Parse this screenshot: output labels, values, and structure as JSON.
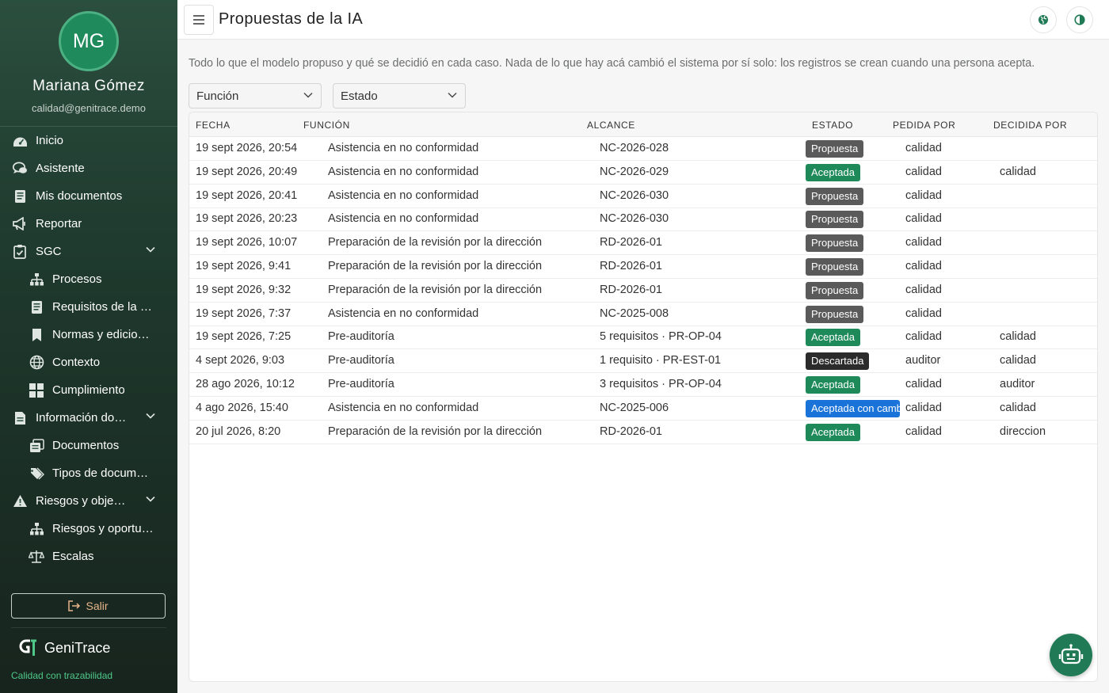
{
  "sidebar": {
    "avatar_initials": "MG",
    "user_name": "Mariana Gómez",
    "user_email": "calidad@genitrace.demo",
    "items": [
      {
        "label": "Inicio",
        "icon": "dashboard-icon",
        "level": 0
      },
      {
        "label": "Asistente",
        "icon": "chat-icon",
        "level": 0
      },
      {
        "label": "Mis documentos",
        "icon": "document-icon",
        "level": 0
      },
      {
        "label": "Reportar",
        "icon": "megaphone-icon",
        "level": 0
      },
      {
        "label": "SGC",
        "icon": "clipboard-check-icon",
        "level": 0,
        "expanded": true
      },
      {
        "label": "Procesos",
        "icon": "sitemap-icon",
        "level": 1
      },
      {
        "label": "Requisitos de la norma",
        "icon": "document-icon",
        "level": 1
      },
      {
        "label": "Normas y ediciones",
        "icon": "bookmark-icon",
        "level": 1
      },
      {
        "label": "Contexto",
        "icon": "globe-icon",
        "level": 1
      },
      {
        "label": "Cumplimiento",
        "icon": "grid-icon",
        "level": 1
      },
      {
        "label": "Información documentada",
        "icon": "file-icon",
        "level": 0,
        "expanded": true
      },
      {
        "label": "Documentos",
        "icon": "files-icon",
        "level": 1
      },
      {
        "label": "Tipos de documento",
        "icon": "tags-icon",
        "level": 1
      },
      {
        "label": "Riesgos y objetivos",
        "icon": "warning-icon",
        "level": 0,
        "expanded": true
      },
      {
        "label": "Riesgos y oportunidades",
        "icon": "sitemap-icon",
        "level": 1
      },
      {
        "label": "Escalas",
        "icon": "scale-icon",
        "level": 1
      }
    ],
    "logout_label": "Salir",
    "brand_name": "GeniTrace",
    "brand_tagline": "Calidad con trazabilidad"
  },
  "header": {
    "title": "Propuestas de la IA"
  },
  "main": {
    "intro": "Todo lo que el modelo propuso y qué se decidió en cada caso. Nada de lo que hay acá cambió el sistema por sí solo: los registros se crean cuando una persona acepta.",
    "filters": [
      {
        "label": "Función"
      },
      {
        "label": "Estado"
      }
    ],
    "columns": [
      "FECHA",
      "FUNCIÓN",
      "ALCANCE",
      "ESTADO",
      "PEDIDA POR",
      "DECIDIDA POR"
    ],
    "rows": [
      {
        "fecha": "19 sept 2026, 20:54",
        "funcion": "Asistencia en no conformidad",
        "alcance": "NC-2026-028",
        "estado": "Propuesta",
        "estado_color": "#5a5a5a",
        "pedida": "calidad",
        "decidida": ""
      },
      {
        "fecha": "19 sept 2026, 20:49",
        "funcion": "Asistencia en no conformidad",
        "alcance": "NC-2026-029",
        "estado": "Aceptada",
        "estado_color": "#1e8a5a",
        "pedida": "calidad",
        "decidida": "calidad"
      },
      {
        "fecha": "19 sept 2026, 20:41",
        "funcion": "Asistencia en no conformidad",
        "alcance": "NC-2026-030",
        "estado": "Propuesta",
        "estado_color": "#5a5a5a",
        "pedida": "calidad",
        "decidida": ""
      },
      {
        "fecha": "19 sept 2026, 20:23",
        "funcion": "Asistencia en no conformidad",
        "alcance": "NC-2026-030",
        "estado": "Propuesta",
        "estado_color": "#5a5a5a",
        "pedida": "calidad",
        "decidida": ""
      },
      {
        "fecha": "19 sept 2026, 10:07",
        "funcion": "Preparación de la revisión por la dirección",
        "alcance": "RD-2026-01",
        "estado": "Propuesta",
        "estado_color": "#5a5a5a",
        "pedida": "calidad",
        "decidida": ""
      },
      {
        "fecha": "19 sept 2026, 9:41",
        "funcion": "Preparación de la revisión por la dirección",
        "alcance": "RD-2026-01",
        "estado": "Propuesta",
        "estado_color": "#5a5a5a",
        "pedida": "calidad",
        "decidida": ""
      },
      {
        "fecha": "19 sept 2026, 9:32",
        "funcion": "Preparación de la revisión por la dirección",
        "alcance": "RD-2026-01",
        "estado": "Propuesta",
        "estado_color": "#5a5a5a",
        "pedida": "calidad",
        "decidida": ""
      },
      {
        "fecha": "19 sept 2026, 7:37",
        "funcion": "Asistencia en no conformidad",
        "alcance": "NC-2025-008",
        "estado": "Propuesta",
        "estado_color": "#5a5a5a",
        "pedida": "calidad",
        "decidida": ""
      },
      {
        "fecha": "19 sept 2026, 7:25",
        "funcion": "Pre-auditoría",
        "alcance": "5 requisitos · PR-OP-04",
        "estado": "Aceptada",
        "estado_color": "#1e8a5a",
        "pedida": "calidad",
        "decidida": "calidad"
      },
      {
        "fecha": "4 sept 2026, 9:03",
        "funcion": "Pre-auditoría",
        "alcance": "1 requisito · PR-EST-01",
        "estado": "Descartada",
        "estado_color": "#2b2b2b",
        "pedida": "auditor",
        "decidida": "calidad"
      },
      {
        "fecha": "28 ago 2026, 10:12",
        "funcion": "Pre-auditoría",
        "alcance": "3 requisitos · PR-OP-04",
        "estado": "Aceptada",
        "estado_color": "#1e8a5a",
        "pedida": "calidad",
        "decidida": "auditor"
      },
      {
        "fecha": "4 ago 2026, 15:40",
        "funcion": "Asistencia en no conformidad",
        "alcance": "NC-2025-006",
        "estado": "Aceptada con cambios",
        "estado_color": "#1a73d9",
        "pedida": "calidad",
        "decidida": "calidad"
      },
      {
        "fecha": "20 jul 2026, 8:20",
        "funcion": "Preparación de la revisión por la dirección",
        "alcance": "RD-2026-01",
        "estado": "Aceptada",
        "estado_color": "#1e8a5a",
        "pedida": "calidad",
        "decidida": "direccion"
      }
    ]
  },
  "colors": {
    "accent": "#1f7a55",
    "sidebar_top": "#2b4f3e",
    "sidebar_bottom": "#17241d"
  }
}
